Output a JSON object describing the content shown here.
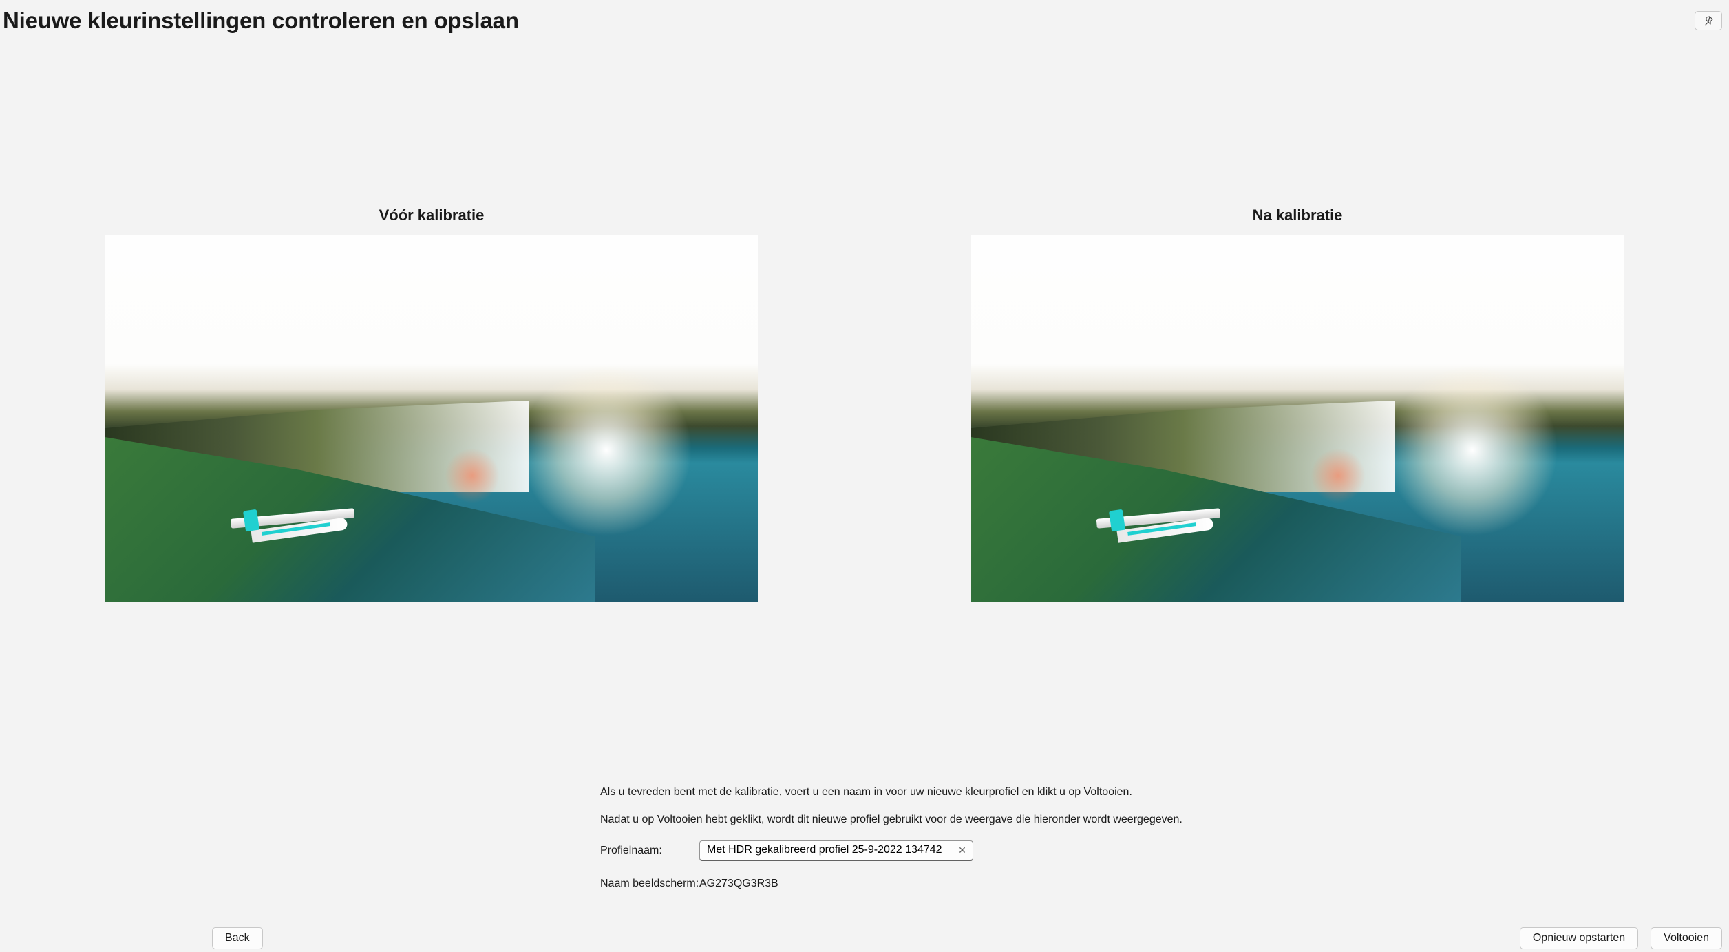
{
  "header": {
    "title": "Nieuwe kleurinstellingen controleren en opslaan"
  },
  "comparison": {
    "before_label": "Vóór kalibratie",
    "after_label": "Na kalibratie"
  },
  "instructions": {
    "line1": "Als u tevreden bent met de kalibratie, voert u een naam in voor uw nieuwe kleurprofiel en klikt u op Voltooien.",
    "line2": "Nadat u op Voltooien hebt geklikt, wordt dit nieuwe profiel gebruikt voor de weergave die hieronder wordt weergegeven."
  },
  "form": {
    "profile_name_label": "Profielnaam:",
    "profile_name_value": "Met HDR gekalibreerd profiel 25-9-2022 134742",
    "display_name_label": "Naam beeldscherm:",
    "display_name_value": "AG273QG3R3B"
  },
  "buttons": {
    "back": "Back",
    "restart": "Opnieuw opstarten",
    "finish": "Voltooien"
  }
}
